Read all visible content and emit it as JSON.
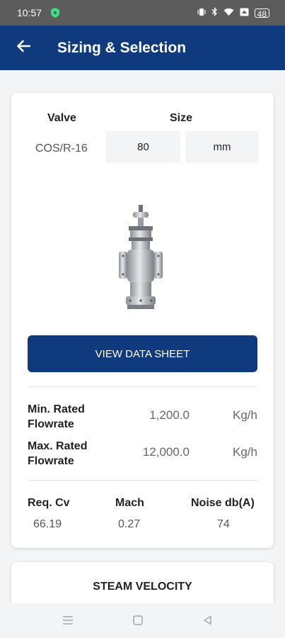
{
  "status_bar": {
    "time": "10:57",
    "battery": "48"
  },
  "app_bar": {
    "title": "Sizing & Selection",
    "back_icon": "arrow-back-icon"
  },
  "selection": {
    "valve_header": "Valve",
    "size_header": "Size",
    "valve_value": "COS/R-16",
    "size_value": "80",
    "size_unit": "mm"
  },
  "product_image": {
    "icon": "pressure-reducing-valve-image"
  },
  "data_sheet_button": "VIEW DATA SHEET",
  "flowrates": [
    {
      "label_line1": "Min. Rated",
      "label_line2": "Flowrate",
      "value": "1,200.0",
      "unit": "Kg/h"
    },
    {
      "label_line1": "Max. Rated",
      "label_line2": "Flowrate",
      "value": "12,000.0",
      "unit": "Kg/h"
    }
  ],
  "metrics": {
    "cv": {
      "label": "Req. Cv",
      "value": "66.19"
    },
    "mach": {
      "label": "Mach",
      "value": "0.27"
    },
    "noise": {
      "label": "Noise db(A)",
      "value": "74"
    }
  },
  "steam_velocity": {
    "title": "STEAM VELOCITY"
  },
  "colors": {
    "primary": "#103a7e",
    "background": "#f3f4f6",
    "status_bar": "#5c5c5c"
  },
  "nav_bar": {
    "icons": [
      "menu-icon",
      "home-icon",
      "back-triangle-icon"
    ]
  }
}
